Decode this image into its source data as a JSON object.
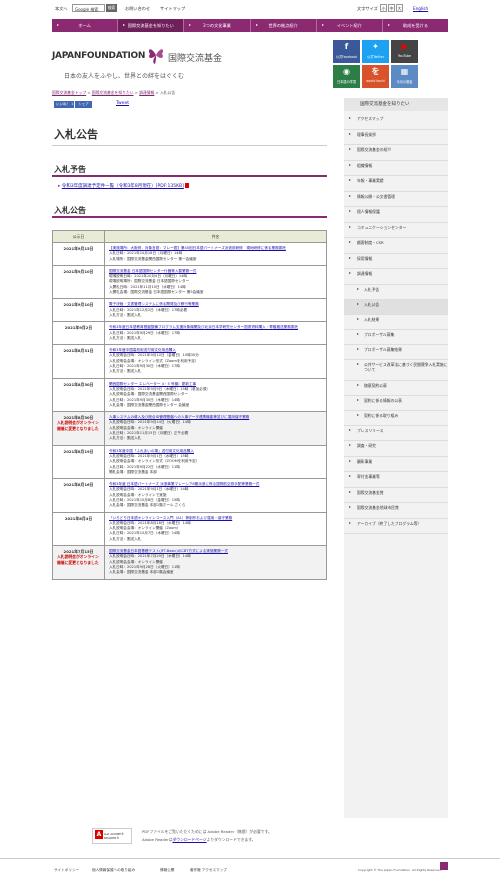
{
  "util": {
    "lang_jp": "本文へ",
    "search_value": "Google 検索",
    "search_btn": "検索",
    "inquiry": "お問い合わせ",
    "sitemap": "サイトマップ",
    "fontsize_label": "文字サイズ",
    "fs_small": "小",
    "fs_mid": "中",
    "fs_large": "大",
    "english": "English"
  },
  "nav": [
    "ホーム",
    "国際交流基金を知りたい",
    "3つの文化事業",
    "世界の拠点紹介",
    "イベント紹介",
    "助成を受ける"
  ],
  "header": {
    "logo_en": "JAPANFOUNDATION",
    "logo_jp": "国際交流基金",
    "tagline": "日本の友人をふやし、世界との絆をはぐくむ"
  },
  "sns": {
    "facebook": "公式Facebook",
    "twitter": "公式Twitter",
    "youtube": "YouTube",
    "nihongo": "日本語の学習",
    "wochi": "wochi kochi",
    "channel": "今月の基金"
  },
  "breadcrumb": [
    "国際交流基金トップ",
    "国際交流基金を知りたい",
    "調達情報",
    "入札公告"
  ],
  "share": {
    "like": "いいね！ 1",
    "share": "シェア",
    "tweet": "Tweet"
  },
  "page_title": "入札公告",
  "yotei": {
    "heading": "入札予告",
    "item": "令和3年度調達予定件一覧（令和3年8月現在）[PDF:135KB]"
  },
  "koukoku_heading": "入札公告",
  "table": {
    "col_date": "公示日",
    "col_name": "件名",
    "rows": [
      {
        "date": "2021年9月15日",
        "note": "",
        "title": "【実施場所：大阪府，対象言語：マレー語】第40回日本語パートナーズ派遣前研修　現地研修に係る業務委託",
        "lines": [
          "入札日時：2021年10月18日（月曜日）14時",
          "入札場所：国際交流基金関西国際センター 第一会議室"
        ],
        "alt": false
      },
      {
        "date": "2021年9月10日",
        "note": "",
        "title": "国際交流基金 日本語国際センター什器等入替業務一式",
        "lines": [
          "現場説明日時：2021年10月4日（月曜日）14時",
          "現場説明場所：国際交流基金 日本語国際センター",
          "入開札日時：2021年11月10日（水曜日）14時",
          "入開札会場：国際交流基金 日本語国際センター 第5会議室"
        ],
        "alt": false
      },
      {
        "date": "2021年9月10日",
        "note": "",
        "title": "電子決裁・文書管理システムに係る開発及び移行等業務",
        "lines": [
          "入札日時：2021年12月2日（木曜日）17時必着",
          "入札方法：郵送入札"
        ],
        "alt": false
      },
      {
        "date": "2021年9月2日",
        "note": "",
        "title": "令和3年度日本語教育基盤整備プログラム支援対象機関及び北京日本学研究センター図書資料購入・寄贈搬送業務委託",
        "lines": [
          "入札日時：2021年9月29日（水曜日）17時",
          "入札方法：郵送入札"
        ],
        "alt": false
      },
      {
        "date": "2021年8月31日",
        "note": "",
        "title": "令和3年度中国高校用送付用文化用品購入",
        "lines": [
          "入札説明会日時：2021年9月10日（金曜日）10時30分",
          "入札説明会会場：オンライン形式（Zoomを利用予定）",
          "入札日時：2021年9月30日（木曜日）17時",
          "入札方法：郵送入札"
        ],
        "alt": false
      },
      {
        "date": "2021年8月30日",
        "note": "",
        "title": "関西国際センター エレベーター 4・5 号機）更新工事",
        "lines": [
          "入札説明会日時：2021年9月9日（木曜日）15時（参加必須）",
          "入札説明会会場：国際交流基金関西国際センター",
          "入札日時：2021年9月30日（木曜日）14時",
          "入札会場：国際交流基金関西国際センター 会議室"
        ],
        "alt": false
      },
      {
        "date": "2021年8月30日",
        "note": "入札説明会がオンライン開催に変更となりました",
        "title": "人事システムの導入及び統合ID管理基盤への人事データ連携機能等並びに運用保守業務",
        "lines": [
          "入札説明会日時：2021年9月14日（火曜日）14時",
          "入札説明会会場：オンライン開催",
          "入札日時：2021年11月15日（月曜日）正午必着",
          "入札方法：郵送入札"
        ],
        "alt": true
      },
      {
        "date": "2021年8月19日",
        "note": "",
        "title": "令和3年度中国「ふれあいの場」送付用文化用品購入",
        "lines": [
          "入札説明会日時：2021年9月1日（水曜日）15時",
          "入札説明会会場：オンライン形式（ZOOMを利用予定）",
          "入札日時：2021年9月22日（水曜日）11時",
          "開札会場：国際交流基金 本部"
        ],
        "alt": false
      },
      {
        "date": "2021年8月16日",
        "note": "",
        "title": "令和3年度 日本語パートナーズ 派遣事業マレーシア8期派遣に係る国際航空券手配等業務一式",
        "lines": [
          "入札説明会日時：2021年9月1日（水曜日）14時",
          "入札説明会会場：オンラインで実施",
          "入札日時：2021年10月8日（金曜日）15時",
          "入札会場：国際交流基金 本部1階ホール さくら"
        ],
        "alt": false
      },
      {
        "date": "2021年8月4日",
        "note": "",
        "title": "「いろどり日本語オンラインコース入門（A1）等制作および運用・保守業務",
        "lines": [
          "入札説明会日時：2021年8月18日（水曜日）14時",
          "入札説明会会場：オンライン開催（Zoom）",
          "入札日時：2021年10月7日（木曜日）14時",
          "入札方法：郵送入札"
        ],
        "alt": false
      },
      {
        "date": "2021年7月15日",
        "note": "入札説明会がオンライン開催に変更となりました",
        "title": "国際交流基金日本語基礎テスト(JFT-Basic)のCBT方式による実施業務一式",
        "lines": [
          "入札説明会日時：2021年7月29日（木曜日）14時",
          "入札説明会会場：オンライン開催",
          "入札日時：2021年9月28日（火曜日）11時",
          "入札会場：国際交流基金 本部1階会議室"
        ],
        "alt": true
      }
    ]
  },
  "adobe": {
    "logo": "Get ADOBE® READER®",
    "line1": "PDFファイルをご覧いただくためには Adobe Reader（無償）が必要です。",
    "line2a": "Adobe Readerは",
    "line2link": "ダウンロードページ",
    "line2b": "よりダウンロードできます。"
  },
  "sidebar": {
    "head": "国際交流基金を知りたい",
    "items": [
      {
        "label": "アクセスマップ",
        "lvl": 0
      },
      {
        "label": "理事長挨拶",
        "lvl": 0
      },
      {
        "label": "国際交流基金の紹介",
        "lvl": 0
      },
      {
        "label": "組織情報",
        "lvl": 0
      },
      {
        "label": "年報・事業実績",
        "lvl": 0
      },
      {
        "label": "情報公開・公文書管理",
        "lvl": 0
      },
      {
        "label": "個人情報保護",
        "lvl": 0
      },
      {
        "label": "コミュニケーションセンター",
        "lvl": 0
      },
      {
        "label": "顧客制度・CSR",
        "lvl": 0
      },
      {
        "label": "採用情報",
        "lvl": 0
      },
      {
        "label": "調達情報",
        "lvl": 0
      },
      {
        "label": "入札予告",
        "lvl": 1
      },
      {
        "label": "入札公告",
        "lvl": 1,
        "cur": true
      },
      {
        "label": "入札結果",
        "lvl": 1
      },
      {
        "label": "プロポーザル募集",
        "lvl": 1
      },
      {
        "label": "プロポーザル募集結果",
        "lvl": 1
      },
      {
        "label": "公共サービス改革法に基づく民間競争入札実施について",
        "lvl": 1
      },
      {
        "label": "随意契約公募",
        "lvl": 1
      },
      {
        "label": "契約に係る情報の公表",
        "lvl": 1
      },
      {
        "label": "契約に係る取り組み",
        "lvl": 1
      },
      {
        "label": "プレスリリース",
        "lvl": 0
      },
      {
        "label": "調査・研究",
        "lvl": 0
      },
      {
        "label": "顕彰事業",
        "lvl": 0
      },
      {
        "label": "寄付金事業等",
        "lvl": 0
      },
      {
        "label": "国際交流基金賞",
        "lvl": 0
      },
      {
        "label": "国際交流基金地球市民賞",
        "lvl": 0
      },
      {
        "label": "アーカイブ（終了したプログラム等）",
        "lvl": 0
      }
    ]
  },
  "footer": {
    "links": [
      "サイトポリシー",
      "個人情報保護への取り組み",
      "情報公開",
      "著作権 アクセスマップ"
    ],
    "copyright": "Copyright © The Japan Foundation. All Rights Reserved."
  }
}
